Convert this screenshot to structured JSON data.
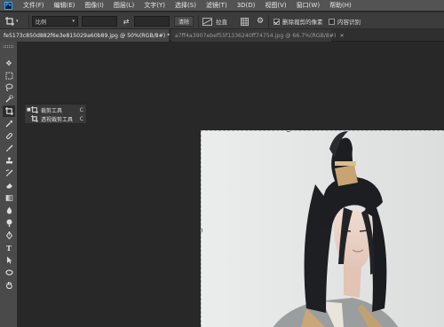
{
  "app": {
    "logo_text": "Ps"
  },
  "menubar": {
    "items": [
      "文件(F)",
      "编辑(E)",
      "图像(I)",
      "图层(L)",
      "文字(Y)",
      "选择(S)",
      "滤镜(T)",
      "3D(D)",
      "视图(V)",
      "窗口(W)",
      "帮助(H)"
    ]
  },
  "options": {
    "ratio_value": "比例",
    "width_value": "",
    "height_value": "",
    "clear_label": "清除",
    "straighten_label": "拉直",
    "delete_cropped_label": "删除裁剪的像素",
    "delete_cropped_checked": true,
    "content_aware_label": "内容识别",
    "content_aware_checked": false
  },
  "tabs": [
    {
      "label": "fe5173c850d882f6e3e815029a60b89.jpg @ 50%(RGB/8#) *",
      "close": "×",
      "active": true
    },
    {
      "label": "a7ff4a3907ebef55f1336240ff74754.jpg @ 66.7%(RGB/8#)",
      "close": "×",
      "active": false
    }
  ],
  "toolbar": {
    "tools": [
      "move-tool",
      "marquee-tool",
      "lasso-tool",
      "quick-select-tool",
      "crop-tool",
      "eyedropper-tool",
      "healing-brush-tool",
      "brush-tool",
      "clone-stamp-tool",
      "history-brush-tool",
      "eraser-tool",
      "gradient-tool",
      "blur-tool",
      "dodge-tool",
      "pen-tool",
      "type-tool",
      "path-select-tool",
      "shape-tool",
      "hand-tool"
    ],
    "active_tool": "crop-tool"
  },
  "flyout": {
    "items": [
      {
        "label": "裁剪工具",
        "shortcut": "C",
        "selected": true
      },
      {
        "label": "透视裁剪工具",
        "shortcut": "C",
        "selected": false
      }
    ]
  },
  "colors": {
    "workspace": "#282828",
    "menubar": "#535353",
    "panel": "#4a4a4a",
    "canvas_bg": "#e9eaeb",
    "accent": "#31a8ff"
  }
}
